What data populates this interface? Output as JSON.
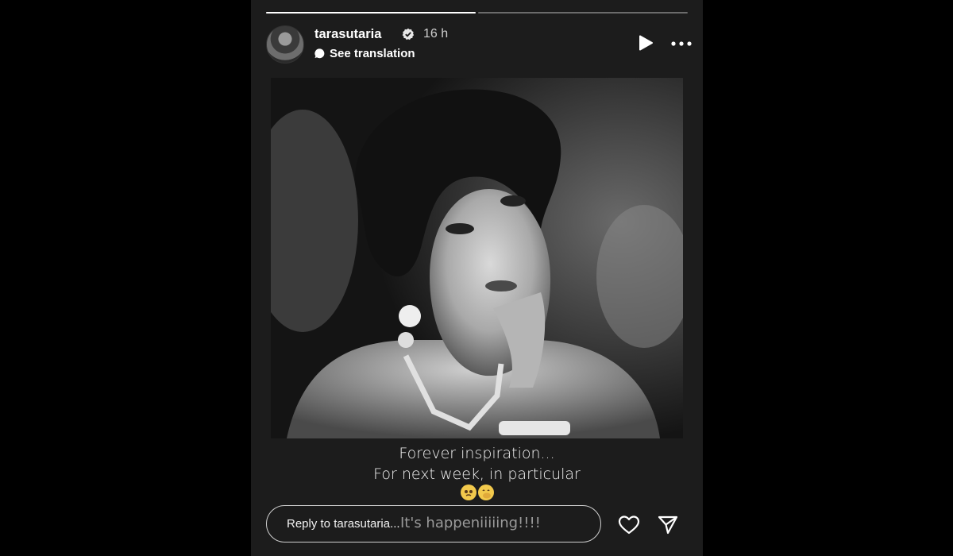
{
  "story": {
    "progress": [
      1.0,
      0.0
    ],
    "user": {
      "username": "tarasutaria",
      "verified": true,
      "time_ago": "16 h",
      "translation_label": "See translation"
    },
    "header_icons": [
      "play-icon",
      "more-icon"
    ],
    "image": {
      "alt_subject": "black-and-white portrait photo"
    },
    "caption": {
      "line1": "Forever inspiration...",
      "line2": "For next week, in particular",
      "emojis": [
        "pleading-face",
        "face-with-hand-over-mouth"
      ]
    },
    "overlay_text": "It's happeniiiiing!!!!",
    "reply": {
      "placeholder": "Reply to tarasutaria..."
    },
    "actions": [
      "heart-icon",
      "send-icon"
    ]
  },
  "colors": {
    "background": "#000000",
    "story_bg": "#1c1c1c",
    "text": "#ffffff",
    "muted": "#9a9a9a",
    "emoji": "#f2c94c"
  }
}
